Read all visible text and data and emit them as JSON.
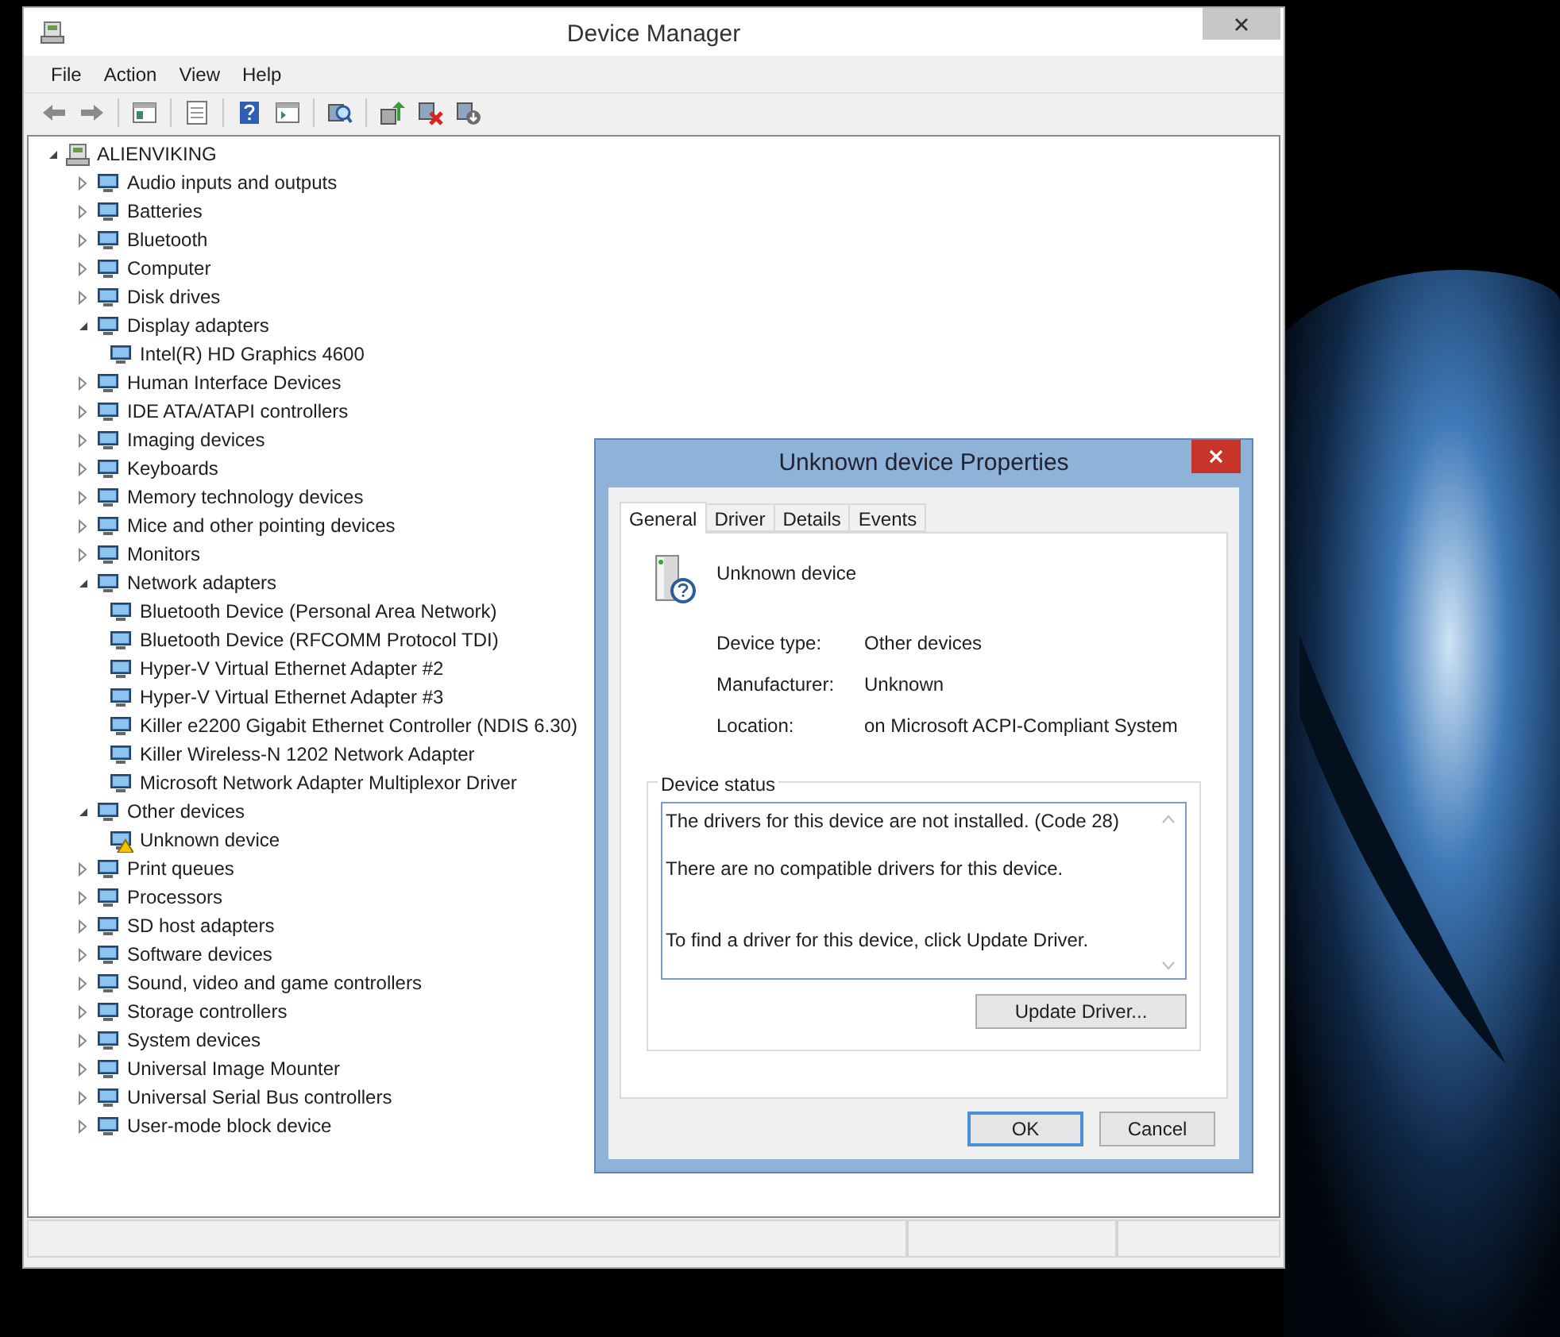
{
  "window": {
    "title": "Device Manager"
  },
  "menu": [
    "File",
    "Action",
    "View",
    "Help"
  ],
  "tree": {
    "label": "ALIENVIKING",
    "expanded": true,
    "children": [
      {
        "label": "Audio inputs and outputs",
        "expanded": false
      },
      {
        "label": "Batteries",
        "expanded": false
      },
      {
        "label": "Bluetooth",
        "expanded": false
      },
      {
        "label": "Computer",
        "expanded": false
      },
      {
        "label": "Disk drives",
        "expanded": false
      },
      {
        "label": "Display adapters",
        "expanded": true,
        "children": [
          {
            "label": "Intel(R) HD Graphics 4600",
            "warning": false
          }
        ]
      },
      {
        "label": "Human Interface Devices",
        "expanded": false
      },
      {
        "label": "IDE ATA/ATAPI controllers",
        "expanded": false
      },
      {
        "label": "Imaging devices",
        "expanded": false
      },
      {
        "label": "Keyboards",
        "expanded": false
      },
      {
        "label": "Memory technology devices",
        "expanded": false
      },
      {
        "label": "Mice and other pointing devices",
        "expanded": false
      },
      {
        "label": "Monitors",
        "expanded": false
      },
      {
        "label": "Network adapters",
        "expanded": true,
        "children": [
          {
            "label": "Bluetooth Device (Personal Area Network)",
            "warning": false
          },
          {
            "label": "Bluetooth Device (RFCOMM Protocol TDI)",
            "warning": false
          },
          {
            "label": "Hyper-V Virtual Ethernet Adapter #2",
            "warning": false
          },
          {
            "label": "Hyper-V Virtual Ethernet Adapter #3",
            "warning": false
          },
          {
            "label": "Killer e2200 Gigabit Ethernet Controller (NDIS 6.30)",
            "warning": false
          },
          {
            "label": "Killer Wireless-N 1202 Network Adapter",
            "warning": false
          },
          {
            "label": "Microsoft Network Adapter Multiplexor Driver",
            "warning": false
          }
        ]
      },
      {
        "label": "Other devices",
        "expanded": true,
        "children": [
          {
            "label": "Unknown device",
            "warning": true
          }
        ]
      },
      {
        "label": "Print queues",
        "expanded": false
      },
      {
        "label": "Processors",
        "expanded": false
      },
      {
        "label": "SD host adapters",
        "expanded": false
      },
      {
        "label": "Software devices",
        "expanded": false
      },
      {
        "label": "Sound, video and game controllers",
        "expanded": false
      },
      {
        "label": "Storage controllers",
        "expanded": false
      },
      {
        "label": "System devices",
        "expanded": false
      },
      {
        "label": "Universal Image Mounter",
        "expanded": false
      },
      {
        "label": "Universal Serial Bus controllers",
        "expanded": false
      },
      {
        "label": "User-mode block device",
        "expanded": false
      }
    ]
  },
  "dialog": {
    "title": "Unknown device Properties",
    "tabs": [
      {
        "label": "General",
        "selected": true
      },
      {
        "label": "Driver",
        "selected": false
      },
      {
        "label": "Details",
        "selected": false
      },
      {
        "label": "Events",
        "selected": false
      }
    ],
    "device_name": "Unknown device",
    "properties": [
      {
        "label": "Device type:",
        "value": "Other devices"
      },
      {
        "label": "Manufacturer:",
        "value": "Unknown"
      },
      {
        "label": "Location:",
        "value": "on Microsoft ACPI-Compliant System"
      }
    ],
    "status_group": "Device status",
    "status_lines": [
      "The drivers for this device are not installed. (Code 28)",
      "There are no compatible drivers for this device.",
      "To find a driver for this device, click Update Driver."
    ],
    "update_button": "Update Driver...",
    "buttons": [
      {
        "label": "OK",
        "default": true
      },
      {
        "label": "Cancel",
        "default": false
      }
    ]
  }
}
